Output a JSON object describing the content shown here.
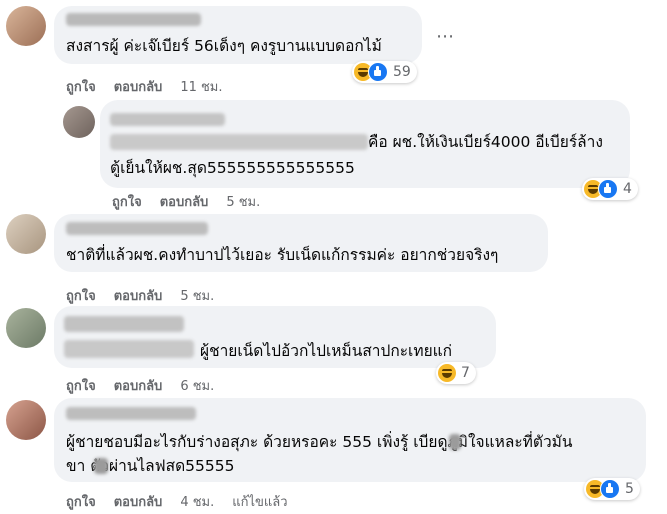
{
  "comments": [
    {
      "text": "สงสารผู้ ค่ะเจ๊เบียร์ 56เด็งๆ คงรูบานแบบดอกไม้",
      "like_label": "ถูกใจ",
      "reply_label": "ตอบกลับ",
      "time": "11 ชม.",
      "reaction_count": "59",
      "avatar_color": "#b3907a"
    },
    {
      "lines": [
        "คือ ผช.ให้เงินเบียร์4000 อีเบียร์ล้าง",
        "ตู้เย็นให้ผช.สุด555555555555555"
      ],
      "like_label": "ถูกใจ",
      "reply_label": "ตอบกลับ",
      "time": "5 ชม.",
      "reaction_count": "4",
      "avatar_color": "#8a7c74"
    },
    {
      "text": "ชาติที่แล้วผช.คงทำบาปไว้เยอะ รับเน็ดแก้กรรมค่ะ อยากช่วยจริงๆ",
      "like_label": "ถูกใจ",
      "reply_label": "ตอบกลับ",
      "time": "5 ชม.",
      "avatar_color": "#c9b9a6"
    },
    {
      "text": "ผู้ชายเน็ดไปอ้วกไปเหม็นสาปกะเทยแก่",
      "like_label": "ถูกใจ",
      "reply_label": "ตอบกลับ",
      "time": "6 ชม.",
      "reaction_count": "7",
      "avatar_color": "#8f9a86"
    },
    {
      "lines": [
        "ผู้ชายชอบมีอะไรกับร่างอสุภะ ด้วยหรอคะ 555 เพิ่งรู้ เบียดูภูมิใจแหละที่ตัวมัน",
        "ขา ตัวผ่านไลฟสด55555"
      ],
      "like_label": "ถูกใจ",
      "reply_label": "ตอบกลับ",
      "time": "4 ชม.",
      "edited": "แก้ไขแล้ว",
      "reaction_count": "5",
      "avatar_color": "#b87f6c"
    }
  ],
  "more_icon": "⋯",
  "colors": {
    "bubble": "#f0f2f5",
    "secondary_text": "#65676b",
    "like_blue": "#1877f2",
    "haha_yellow": "#f7b928"
  }
}
